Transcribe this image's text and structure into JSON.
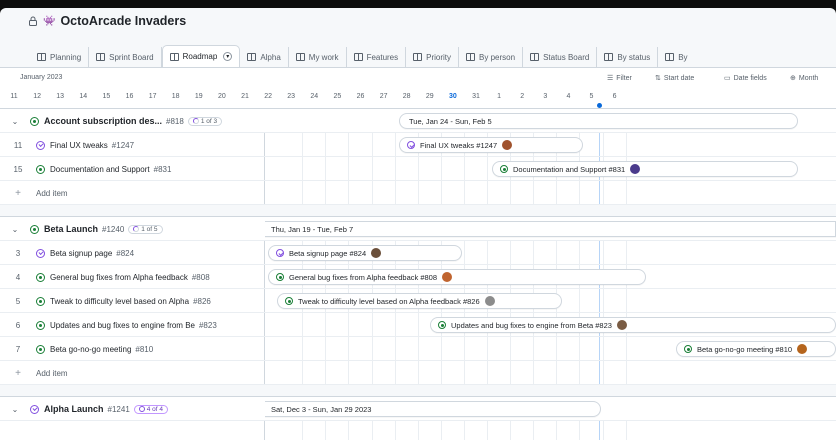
{
  "window": {
    "title": "OctoArcade Invaders"
  },
  "tabs": [
    {
      "label": "Planning",
      "active": false
    },
    {
      "label": "Sprint Board",
      "active": false
    },
    {
      "label": "Roadmap",
      "active": true
    },
    {
      "label": "Alpha",
      "active": false
    },
    {
      "label": "My work",
      "active": false
    },
    {
      "label": "Features",
      "active": false
    },
    {
      "label": "Priority",
      "active": false
    },
    {
      "label": "By person",
      "active": false
    },
    {
      "label": "Status Board",
      "active": false
    },
    {
      "label": "By status",
      "active": false
    },
    {
      "label": "By",
      "active": false
    }
  ],
  "toolbar": {
    "month_label": "January 2023",
    "filter_label": "Filter",
    "start_date_label": "Start date",
    "date_fields_label": "Date fields",
    "zoom_label": "Month"
  },
  "timeline": {
    "days": [
      "11",
      "12",
      "13",
      "14",
      "15",
      "16",
      "17",
      "18",
      "19",
      "20",
      "21",
      "22",
      "23",
      "24",
      "25",
      "26",
      "27",
      "28",
      "29",
      "30",
      "31",
      "1",
      "2",
      "3",
      "4",
      "5",
      "6"
    ],
    "today": "30"
  },
  "groups": [
    {
      "title": "Account subscription des...",
      "number": "#818",
      "progress": "1 of 3",
      "range_label": "Tue, Jan 24 - Sun, Feb 5",
      "items": [
        {
          "num": "11",
          "title": "Final UX tweaks",
          "number": "#1247",
          "status": "done",
          "bar_label": "Final UX tweaks #1247",
          "avatar_color": "#a0522d"
        },
        {
          "num": "15",
          "title": "Documentation and Support",
          "number": "#831",
          "status": "open",
          "bar_label": "Documentation and Support #831",
          "avatar_color": "#4b3b8c"
        }
      ],
      "add_label": "Add item"
    },
    {
      "title": "Beta Launch",
      "number": "#1240",
      "progress": "1 of 5",
      "range_label": "Thu, Jan 19 - Tue, Feb 7",
      "items": [
        {
          "num": "3",
          "title": "Beta signup page",
          "number": "#824",
          "status": "done",
          "bar_label": "Beta signup page #824",
          "avatar_color": "#6b4f3a"
        },
        {
          "num": "4",
          "title": "General bug fixes from Alpha feedback",
          "number": "#808",
          "status": "open",
          "bar_label": "General bug fixes from Alpha feedback #808",
          "avatar_color": "#c0642f"
        },
        {
          "num": "5",
          "title": "Tweak to difficulty level based on Alpha",
          "number": "#826",
          "status": "open",
          "bar_label": "Tweak to difficulty level based on Alpha feedback #826",
          "avatar_color": "#8c8c8c"
        },
        {
          "num": "6",
          "title": "Updates and bug fixes to engine from Be",
          "number": "#823",
          "status": "open",
          "bar_label": "Updates and bug fixes to engine from Beta #823",
          "avatar_color": "#7a5c44"
        },
        {
          "num": "7",
          "title": "Beta go-no-go meeting",
          "number": "#810",
          "status": "open",
          "bar_label": "Beta go-no-go meeting #810",
          "avatar_color": "#b5651d"
        }
      ],
      "add_label": "Add item"
    },
    {
      "title": "Alpha Launch",
      "number": "#1241",
      "progress": "4 of 4",
      "range_label": "Sat, Dec 3 - Sun, Jan 29 2023"
    }
  ]
}
